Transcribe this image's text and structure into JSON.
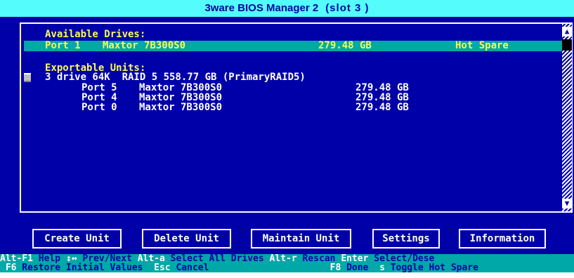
{
  "title": {
    "app": "3ware BIOS Manager 2",
    "slot": "(slot 3 )"
  },
  "available": {
    "header": "Available Drives:",
    "drives": [
      {
        "port": "Port 1",
        "model": "Maxtor 7B300S0",
        "size": "279.48 GB",
        "status": "Hot Spare"
      }
    ]
  },
  "exportable": {
    "header": "Exportable Units:",
    "unit_line": "3 drive 64K  RAID 5 558.77 GB (PrimaryRAID5)",
    "members": [
      {
        "port": "Port 5",
        "model": "Maxtor 7B300S0",
        "size": "279.48 GB"
      },
      {
        "port": "Port 4",
        "model": "Maxtor 7B300S0",
        "size": "279.48 GB"
      },
      {
        "port": "Port 0",
        "model": "Maxtor 7B300S0",
        "size": "279.48 GB"
      }
    ]
  },
  "buttons": {
    "create": "Create Unit",
    "delete": "Delete Unit",
    "maintain": "Maintain Unit",
    "settings": "Settings",
    "information": "Information"
  },
  "help": {
    "line1": [
      {
        "key": "Alt-F1",
        "text": " Help "
      },
      {
        "key": "↕↔",
        "text": " Prev/Next "
      },
      {
        "key": "Alt-a",
        "text": " Select All Drives "
      },
      {
        "key": "Alt-r",
        "text": " Rescan "
      },
      {
        "key": "Enter",
        "text": " Select/Dese"
      }
    ],
    "line2": [
      {
        "key": " F6",
        "text": " Restore Initial Values  "
      },
      {
        "key": "Esc",
        "text": " Cancel                      "
      },
      {
        "key": "F8",
        "text": " Done  "
      },
      {
        "key": "s",
        "text": " Toggle Hot Spare"
      }
    ]
  },
  "icons": {
    "scroll_up": "arrow-up-icon",
    "scroll_down": "arrow-down-icon"
  },
  "colors": {
    "background": "#0000a8",
    "accent": "#54fcfc",
    "header": "#fcfc54",
    "selection": "#00a8a8"
  }
}
